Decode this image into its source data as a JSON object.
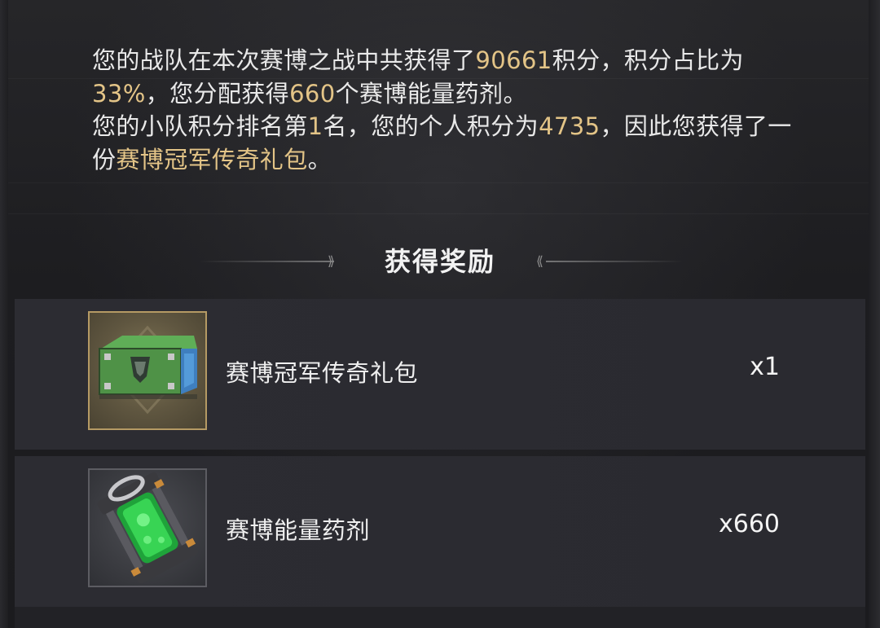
{
  "message": {
    "line1_a": "您的战队在本次赛博之战中共获得了",
    "team_points": "90661",
    "line1_b": "积分，积分占比为",
    "share_percent": "33%",
    "line1_c": "，您分配获得",
    "potion_count": "660",
    "line1_d": "个赛博能量药剂。",
    "line2_a": "您的小队积分排名第",
    "squad_rank": "1",
    "line2_b": "名，您的个人积分为",
    "personal_points": "4735",
    "line2_c": "，因此您获得了一份",
    "pack_name": "赛博冠军传奇礼包",
    "line2_d": "。"
  },
  "rewards_section": {
    "title": "获得奖励"
  },
  "rewards": [
    {
      "name": "赛博冠军传奇礼包",
      "quantity": "x1",
      "icon": "legendary-crate-icon"
    },
    {
      "name": "赛博能量药剂",
      "quantity": "x660",
      "icon": "energy-potion-icon"
    }
  ],
  "colors": {
    "highlight": "#e3c487",
    "legendary_border": "#b59a64",
    "common_border": "#5c5c62"
  }
}
